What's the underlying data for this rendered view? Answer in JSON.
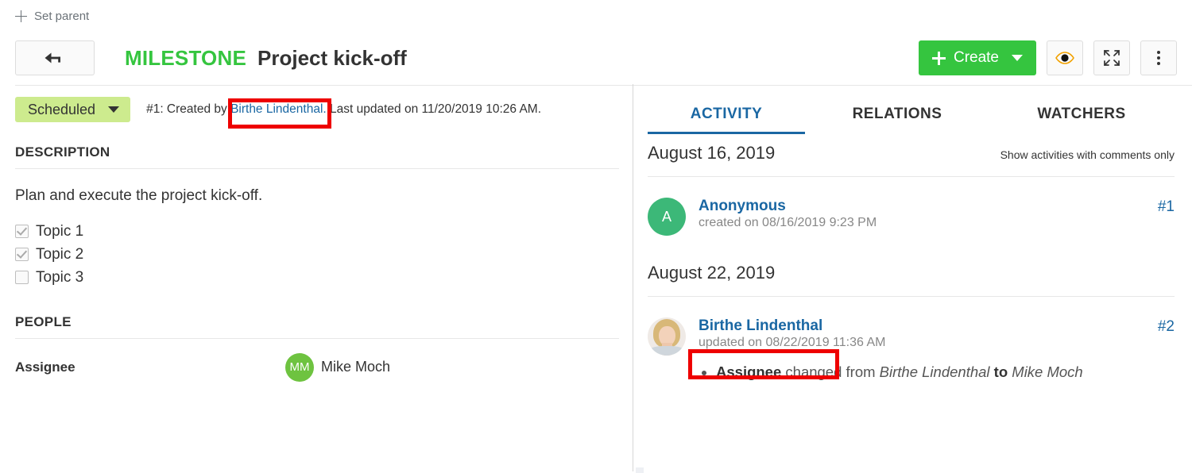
{
  "breadcrumb": {
    "set_parent_label": "Set parent",
    "plus_icon": "plus-icon"
  },
  "toolbar": {
    "back_icon": "back-arrow-icon",
    "type_label": "MILESTONE",
    "subject": "Project kick-off",
    "create_label": "Create",
    "create_caret_icon": "chevron-down-icon",
    "watch_icon": "eye-icon",
    "fullscreen_icon": "fullscreen-icon",
    "more_icon": "more-vertical-icon",
    "type_color": "#35c53f",
    "create_color": "#35c53f"
  },
  "details": {
    "status": {
      "label": "Scheduled",
      "color": "#cdeb8e",
      "caret_icon": "chevron-down-icon"
    },
    "meta": {
      "prefix": "#1: Created by ",
      "author": "Birthe Lindenthal.",
      "suffix": " Last updated on 11/20/2019 10:26 AM."
    },
    "description": {
      "heading": "DESCRIPTION",
      "text": "Plan and execute the project kick-off.",
      "checklist": [
        {
          "label": "Topic 1",
          "checked": true
        },
        {
          "label": "Topic 2",
          "checked": true
        },
        {
          "label": "Topic 3",
          "checked": false
        }
      ]
    },
    "people": {
      "heading": "PEOPLE",
      "assignee_label": "Assignee",
      "assignee_name": "Mike Moch",
      "assignee_initials": "MM",
      "assignee_avatar_color": "#6ec340"
    }
  },
  "activity_panel": {
    "tabs": [
      {
        "label": "ACTIVITY",
        "active": true
      },
      {
        "label": "RELATIONS",
        "active": false
      },
      {
        "label": "WATCHERS",
        "active": false
      }
    ],
    "active_tab_color": "#1a67a3",
    "filter_label": "Show activities with comments only",
    "groups": [
      {
        "date": "August 16, 2019",
        "entries": [
          {
            "user": "Anonymous",
            "avatar_type": "initials",
            "avatar_initials": "A",
            "avatar_color": "#3cb878",
            "timestamp": "created on 08/16/2019 9:23 PM",
            "number": "#1",
            "changes": []
          }
        ]
      },
      {
        "date": "August 22, 2019",
        "entries": [
          {
            "user": "Birthe Lindenthal",
            "avatar_type": "photo",
            "avatar_initials": "",
            "avatar_color": "",
            "timestamp": "updated on 08/22/2019 11:36 AM",
            "number": "#2",
            "changes": [
              {
                "field": "Assignee",
                "verb": " changed from ",
                "from": "Birthe Lindenthal",
                "joiner": " to ",
                "to": "Mike Moch"
              }
            ]
          }
        ]
      }
    ]
  },
  "annotations": {
    "highlight_color": "#ee0000",
    "boxes": [
      {
        "target": "details-meta-author-link"
      },
      {
        "target": "activity-2-user-link"
      }
    ]
  }
}
